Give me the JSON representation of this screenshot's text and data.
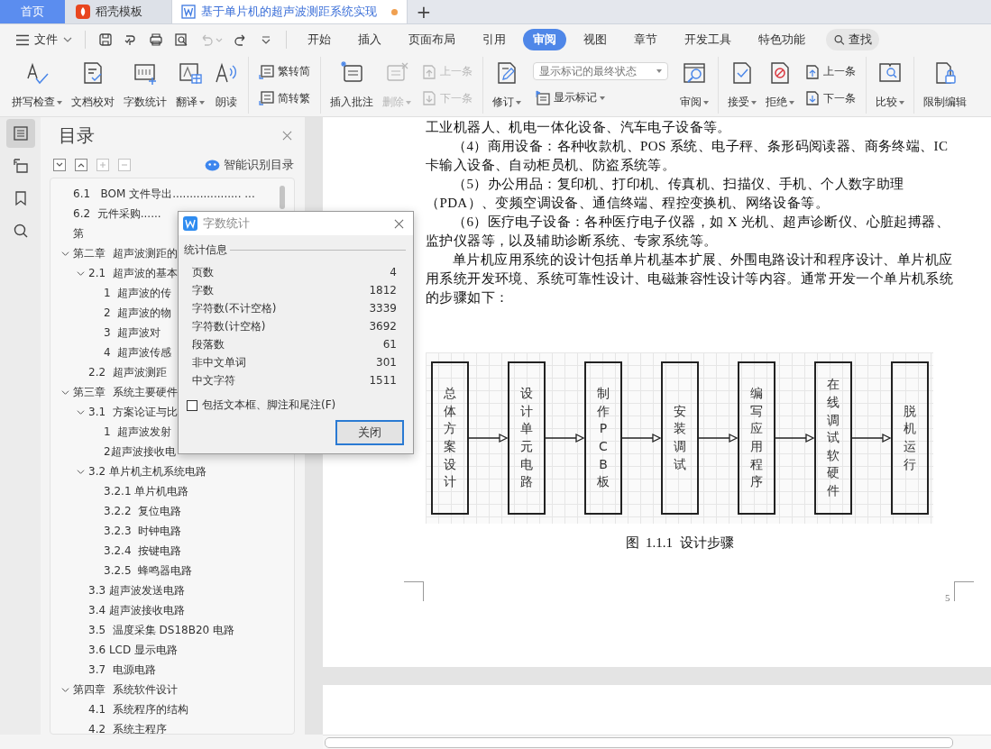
{
  "tabs": [
    {
      "kind": "home",
      "label": "首页",
      "selected": false
    },
    {
      "kind": "app",
      "label": "稻壳模板",
      "selected": false
    },
    {
      "kind": "doc",
      "label": "基于单片机的超声波测距系统实现",
      "selected": true,
      "modified": true
    }
  ],
  "new_tab_button": "+",
  "menu": {
    "file": "文件",
    "search": "查找",
    "tabs": [
      {
        "label": "开始",
        "selected": false
      },
      {
        "label": "插入",
        "selected": false
      },
      {
        "label": "页面布局",
        "selected": false
      },
      {
        "label": "引用",
        "selected": false
      },
      {
        "label": "审阅",
        "selected": true
      },
      {
        "label": "视图",
        "selected": false
      },
      {
        "label": "章节",
        "selected": false
      },
      {
        "label": "开发工具",
        "selected": false
      },
      {
        "label": "特色功能",
        "selected": false
      }
    ]
  },
  "ribbon": {
    "proofing": [
      {
        "label": "拼写检查",
        "dropdown": true
      },
      {
        "label": "文档校对",
        "dropdown": false
      },
      {
        "label": "字数统计",
        "dropdown": false
      },
      {
        "label": "翻译",
        "dropdown": true
      },
      {
        "label": "朗读",
        "dropdown": false
      }
    ],
    "convert": [
      "繁转简",
      "简转繁"
    ],
    "comments": {
      "insert": "插入批注",
      "delete": {
        "label": "删除",
        "disabled": true
      },
      "prev": {
        "label": "上一条",
        "disabled": true
      },
      "next": {
        "label": "下一条",
        "disabled": true
      }
    },
    "tracking": {
      "revise": "修订",
      "markup_select": "显示标记的最终状态",
      "show_markup": "显示标记",
      "review": "审阅"
    },
    "changes": {
      "accept": "接受",
      "reject": "拒绝",
      "prev": {
        "label": "上一条",
        "disabled": false
      },
      "next": {
        "label": "下一条",
        "disabled": false
      }
    },
    "compare": "比较",
    "restrict": "限制编辑"
  },
  "rail": [
    {
      "selected": true
    },
    {
      "selected": false
    },
    {
      "selected": false
    },
    {
      "selected": false
    }
  ],
  "toc": {
    "title": "目录",
    "smart": "智能识别目录",
    "items": [
      {
        "text": "6.1   BOM 文件导出.................... ..."
      },
      {
        "text": "6.2  元件采购......"
      },
      {
        "text": "第"
      },
      {
        "text": "第二章  超声波测距的",
        "expanded": true,
        "children": [
          {
            "text": "2.1  超声波的基本",
            "expanded": true,
            "children": [
              {
                "text": "1  超声波的传"
              },
              {
                "text": "2  超声波的物"
              },
              {
                "text": "3  超声波对"
              },
              {
                "text": "4  超声波传感"
              }
            ]
          },
          {
            "text": "2.2  超声波测距"
          }
        ]
      },
      {
        "text": "第三章  系统主要硬件",
        "expanded": true,
        "children": [
          {
            "text": "3.1  方案论证与比",
            "expanded": true,
            "children": [
              {
                "text": "1  超声波发射"
              },
              {
                "text": "2超声波接收电"
              }
            ]
          },
          {
            "text": "3.2 单片机主机系统电路",
            "expanded": true,
            "children": [
              {
                "text": "3.2.1 单片机电路"
              },
              {
                "text": "3.2.2  复位电路"
              },
              {
                "text": "3.2.3  时钟电路"
              },
              {
                "text": "3.2.4  按键电路"
              },
              {
                "text": "3.2.5  蜂鸣器电路"
              }
            ]
          },
          {
            "text": "3.3 超声波发送电路"
          },
          {
            "text": "3.4 超声波接收电路"
          },
          {
            "text": "3.5  温度采集 DS18B20 电路"
          },
          {
            "text": "3.6 LCD 显示电路"
          },
          {
            "text": "3.7  电源电路"
          }
        ]
      },
      {
        "text": "第四章  系统软件设计",
        "expanded": true,
        "children": [
          {
            "text": "4.1  系统程序的结构"
          },
          {
            "text": "4.2  系统主程序"
          }
        ]
      }
    ]
  },
  "document": {
    "paragraphs": [
      {
        "indent": false,
        "text": "工业机器人、机电一体化设备、汽车电子设备等。"
      },
      {
        "indent": true,
        "text": "（4）商用设备：各种收款机、POS 系统、电子秤、条形码阅读器、商务终端、IC 卡输入设备、自动柜员机、防盗系统等。"
      },
      {
        "indent": true,
        "text": "（5）办公用品：复印机、打印机、传真机、扫描仪、手机、个人数字助理（PDA）、变频空调设备、通信终端、程控变换机、网络设备等。"
      },
      {
        "indent": true,
        "text": "（6）医疗电子设备：各种医疗电子仪器，如 X 光机、超声诊断仪、心脏起搏器、监护仪器等，以及辅助诊断系统、专家系统等。"
      },
      {
        "indent": true,
        "text": "单片机应用系统的设计包括单片机基本扩展、外围电路设计和程序设计、单片机应用系统开发环境、系统可靠性设计、电磁兼容性设计等内容。通常开发一个单片机系统的步骤如下："
      }
    ],
    "flow_steps": [
      "总体方案设计",
      "设计单元电路",
      "制作PCB板",
      "安装调试",
      "编写应用程序",
      "在线调试软硬件",
      "脱机运行"
    ],
    "caption": "图  1.1.1  设计步骤",
    "page_number": "5"
  },
  "dialog": {
    "title": "字数统计",
    "section": "统计信息",
    "rows": [
      {
        "label": "页数",
        "value": "4"
      },
      {
        "label": "字数",
        "value": "1812"
      },
      {
        "label": "字符数(不计空格)",
        "value": "3339"
      },
      {
        "label": "字符数(计空格)",
        "value": "3692"
      },
      {
        "label": "段落数",
        "value": "61"
      },
      {
        "label": "非中文单词",
        "value": "301"
      },
      {
        "label": "中文字符",
        "value": "1511"
      }
    ],
    "checkbox": {
      "label": "包括文本框、脚注和尾注(F)",
      "checked": false
    },
    "button": "关闭"
  }
}
